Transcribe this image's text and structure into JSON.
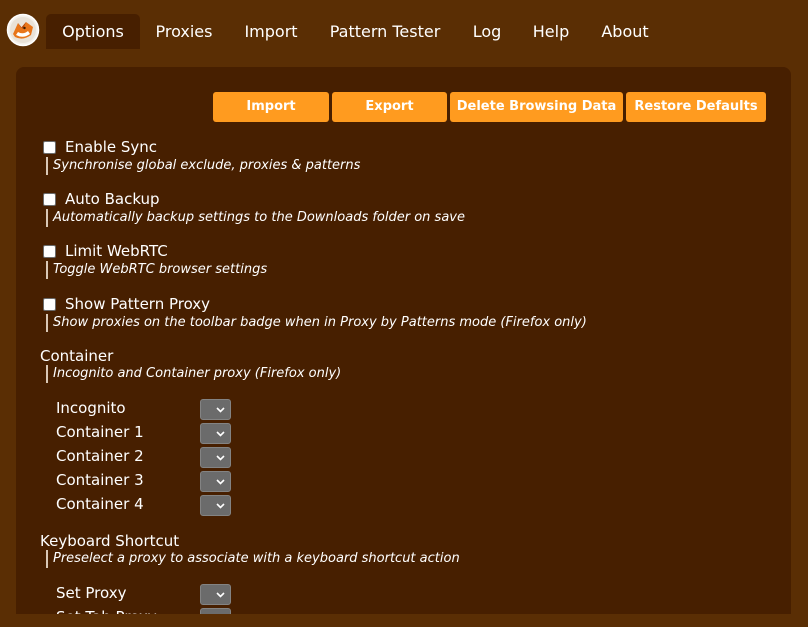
{
  "tabs": [
    {
      "label": "Options"
    },
    {
      "label": "Proxies"
    },
    {
      "label": "Import"
    },
    {
      "label": "Pattern Tester"
    },
    {
      "label": "Log"
    },
    {
      "label": "Help"
    },
    {
      "label": "About"
    }
  ],
  "actions": {
    "import_label": "Import",
    "export_label": "Export",
    "delete_label": "Delete Browsing Data",
    "restore_label": "Restore Defaults"
  },
  "options": [
    {
      "label": "Enable Sync",
      "description": "Synchronise global exclude, proxies & patterns",
      "checked": false
    },
    {
      "label": "Auto Backup",
      "description": "Automatically backup settings to the Downloads folder on save",
      "checked": false
    },
    {
      "label": "Limit WebRTC",
      "description": "Toggle WebRTC browser settings",
      "checked": false
    },
    {
      "label": "Show Pattern Proxy",
      "description": "Show proxies on the toolbar badge when in Proxy by Patterns mode (Firefox only)",
      "checked": false
    }
  ],
  "container": {
    "title": "Container",
    "description": "Incognito and Container proxy (Firefox only)",
    "rows": [
      {
        "label": "Incognito",
        "value": ""
      },
      {
        "label": "Container 1",
        "value": ""
      },
      {
        "label": "Container 2",
        "value": ""
      },
      {
        "label": "Container 3",
        "value": ""
      },
      {
        "label": "Container 4",
        "value": ""
      }
    ]
  },
  "shortcut": {
    "title": "Keyboard Shortcut",
    "description": "Preselect a proxy to associate with a keyboard shortcut action",
    "rows": [
      {
        "label": "Set Proxy",
        "value": ""
      },
      {
        "label": "Set Tab Proxy",
        "value": ""
      }
    ]
  },
  "colors": {
    "background": "#5a2e04",
    "panel": "#471f00",
    "accent": "#ff9b1f",
    "select": "#6b6b6b"
  },
  "icons": {
    "logo": "fox-logo-icon",
    "select_arrow": "chevron-down-icon"
  }
}
